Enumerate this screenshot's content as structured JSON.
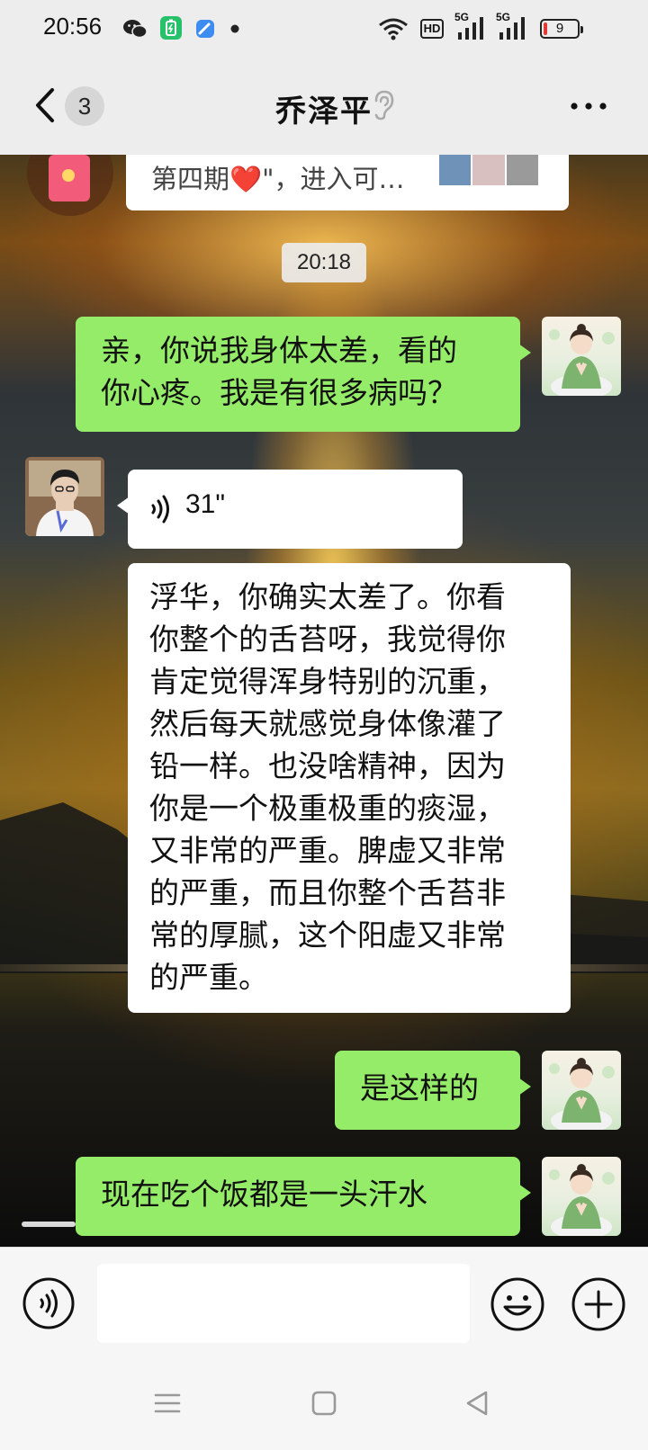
{
  "status_bar": {
    "time": "20:56",
    "battery_level": "9",
    "icons": [
      "wechat-icon",
      "battery-saver-icon",
      "app-icon",
      "dot-icon",
      "wifi-icon",
      "hd-icon",
      "signal-5g-icon",
      "signal-5g-icon",
      "battery-icon"
    ],
    "hd_label": "HD",
    "network_label": "5G"
  },
  "header": {
    "back_count": "3",
    "title": "乔泽平",
    "icons": [
      "back-icon",
      "ear-icon",
      "more-icon"
    ]
  },
  "messages": {
    "shared_card_text": "第四期❤️\"，进入可…",
    "timestamp": "20:18",
    "msg1": {
      "sender": "me",
      "lines": [
        "亲，你说我身体太差，看的",
        "你心疼。我是有很多病吗？"
      ]
    },
    "voice": {
      "sender": "other",
      "duration": "31\""
    },
    "msg2": {
      "sender": "other",
      "lines": [
        "浮华，你确实太差了。你看",
        "你整个的舌苔呀，我觉得你",
        "肯定觉得浑身特别的沉重，",
        "然后每天就感觉身体像灌了",
        "铅一样。也没啥精神，因为",
        "你是一个极重极重的痰湿，",
        "又非常的严重。脾虚又非常",
        "的严重，而且你整个舌苔非",
        "常的厚腻，这个阳虚又非常",
        "的严重。"
      ]
    },
    "msg3": {
      "sender": "me",
      "text": "是这样的"
    },
    "msg4": {
      "sender": "me",
      "text": "现在吃个饭都是一头汗水"
    }
  },
  "input_bar": {
    "value": "",
    "icons": [
      "voice-input-icon",
      "emoji-icon",
      "plus-icon"
    ]
  },
  "nav_bar": {
    "icons": [
      "menu-icon",
      "home-icon",
      "back-triangle-icon"
    ]
  },
  "colors": {
    "my_bubble": "#95ec69",
    "other_bubble": "#ffffff",
    "bar_background": "#ededed"
  }
}
